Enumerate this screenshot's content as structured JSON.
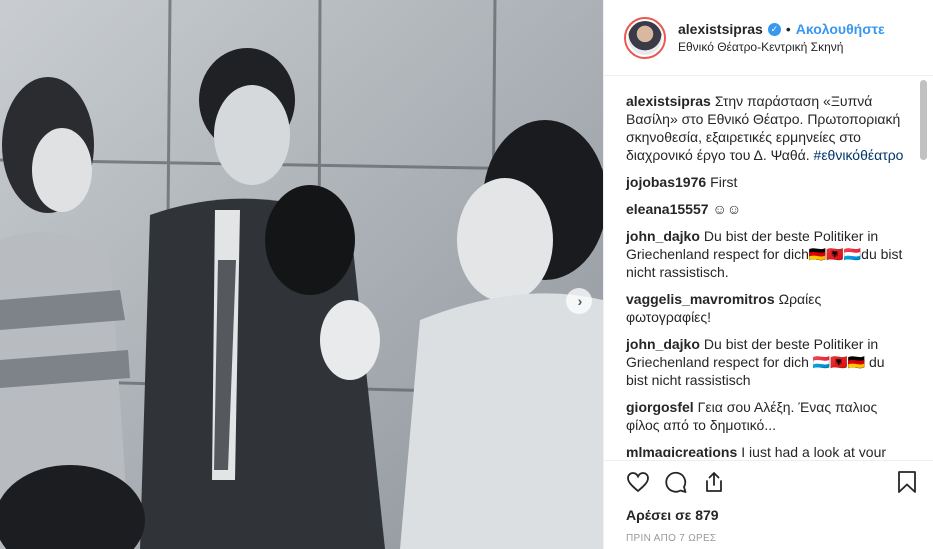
{
  "post": {
    "username": "alexistsipras",
    "follow_label": "Ακολουθήστε",
    "separator": "•",
    "location": "Εθνικό Θέατρο-Κεντρική Σκηνή",
    "likes_label": "Αρέσει σε 879",
    "time_label": "ΠΡΙΝ ΑΠΟ 7 ΩΡΕΣ",
    "carousel_next": "›"
  },
  "caption": {
    "user": "alexistsipras",
    "text": "Στην παράσταση «Ξυπνά Βασίλη» στο Εθνικό Θέατρο. Πρωτοποριακή σκηνοθεσία, εξαιρετικές ερμηνείες στο διαχρονικό έργο του Δ. Ψαθά.",
    "hashtag": "#εθνικόθέατρο"
  },
  "comments": [
    {
      "user": "jojobas1976",
      "text": "First"
    },
    {
      "user": "eleana15557",
      "text": "☺☺"
    },
    {
      "user": "john_dajko",
      "text": "Du bist der beste Politiker in Griechenland respect for dich🇩🇪🇦🇱🇱🇺du bist nicht rassistisch."
    },
    {
      "user": "vaggelis_mavromitros",
      "text": "Ωραίες φωτογραφίες!"
    },
    {
      "user": "john_dajko",
      "text": "Du bist der beste Politiker in Griechenland respect for dich 🇱🇺🇦🇱🇩🇪 du bist nicht rassistisch"
    },
    {
      "user": "giorgosfel",
      "text": "Γεια σου Αλέξη. Ένας παλιος φίλος από το δημοτικό..."
    },
    {
      "user": "mlmagicreations",
      "text": "I just had a look at your"
    }
  ],
  "icons": [
    "heart-icon",
    "comment-icon",
    "share-icon",
    "bookmark-icon",
    "verified-icon"
  ],
  "colors": {
    "accent": "#3897f0",
    "text": "#262626",
    "muted": "#999999",
    "border": "#efefef"
  }
}
